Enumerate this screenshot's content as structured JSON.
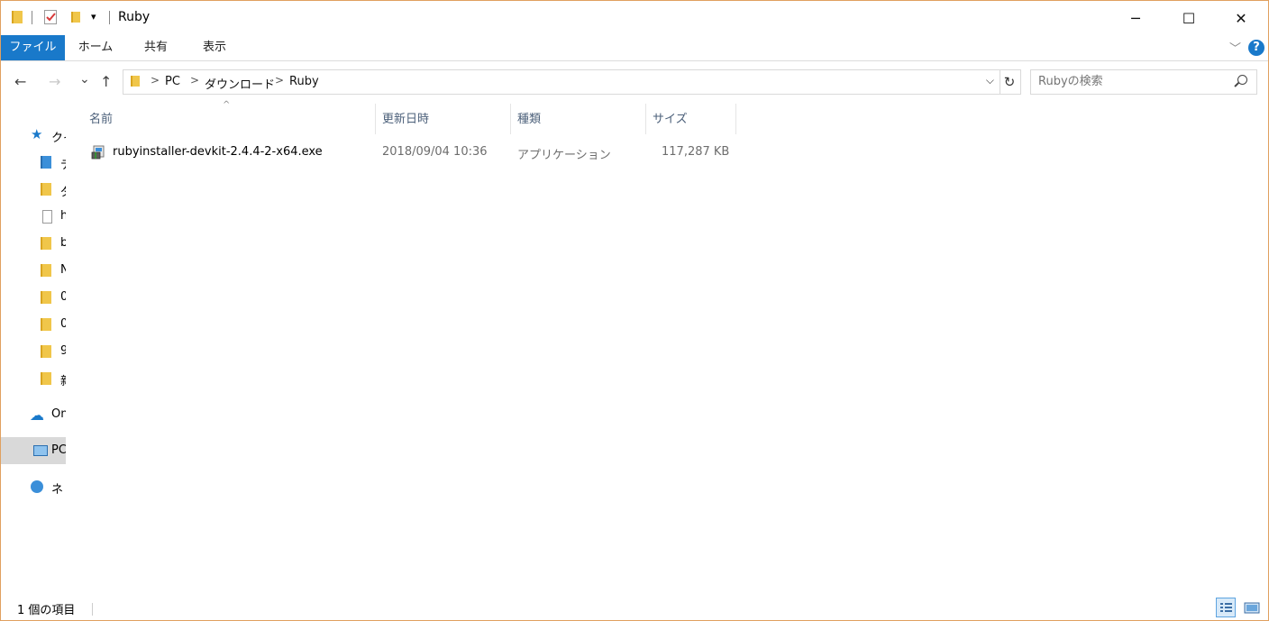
{
  "window": {
    "title": "Ruby",
    "minimize": "─",
    "maximize": "☐",
    "close": "✕"
  },
  "quick_access_toolbar": {
    "dropdown": "▾"
  },
  "ribbon": {
    "tabs": [
      "ファイル",
      "ホーム",
      "共有",
      "表示"
    ],
    "expand": "﹀",
    "help": "?"
  },
  "navigation": {
    "back": "←",
    "forward": "→",
    "recent": "⌄",
    "up": "↑"
  },
  "address": {
    "crumbs": [
      "PC",
      "ダウンロード",
      "Ruby"
    ],
    "separator": ">",
    "dropdown": "⌵",
    "refresh": "↻"
  },
  "search": {
    "placeholder": "Rubyの検索"
  },
  "sidebar": {
    "quick_access": "クイ",
    "items": [
      "デ",
      "ダ",
      "h",
      "b",
      "N",
      "0",
      "0",
      "9",
      "新"
    ],
    "onedrive": "On",
    "pc": "PC",
    "network": "ネ"
  },
  "columns": {
    "name": "名前",
    "modified": "更新日時",
    "type": "種類",
    "size": "サイズ",
    "sort_indicator": "^"
  },
  "files": [
    {
      "name": "rubyinstaller-devkit-2.4.4-2-x64.exe",
      "modified": "2018/09/04 10:36",
      "type": "アプリケーション",
      "size": "117,287 KB"
    }
  ],
  "status": {
    "count": "1 個の項目"
  },
  "colors": {
    "accent": "#1979ca",
    "window_border": "#e0a060",
    "folder": "#f0c64a",
    "selected_nav": "#d9d9d9",
    "column_header_text": "#4c607a"
  }
}
